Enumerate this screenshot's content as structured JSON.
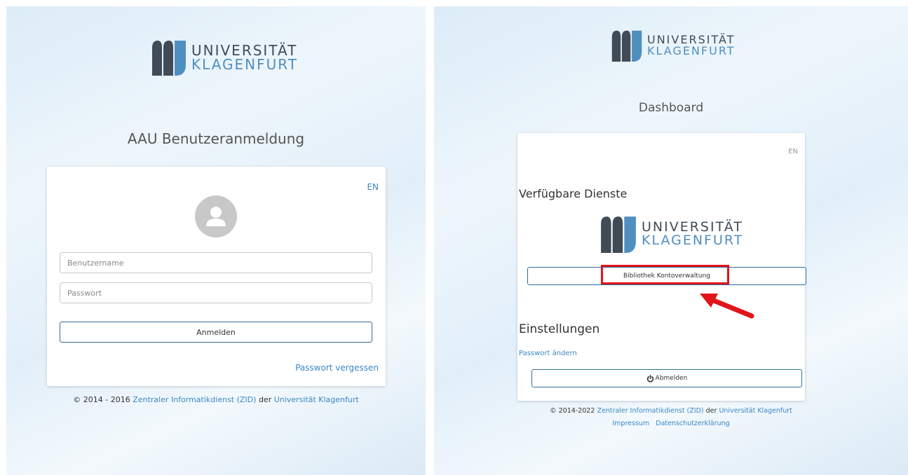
{
  "login": {
    "logo": {
      "line1": "UNIVERSITÄT",
      "line2": "KLAGENFURT"
    },
    "title": "AAU Benutzeranmeldung",
    "lang": "EN",
    "username_placeholder": "Benutzername",
    "password_placeholder": "Passwort",
    "submit_label": "Anmelden",
    "forgot_label": "Passwort vergessen",
    "footer": {
      "copyright": "© 2014 - 2016",
      "zid_link": "Zentraler Informatikdienst (ZID)",
      "der": "der",
      "uni_link": "Universität Klagenfurt"
    }
  },
  "dashboard": {
    "logo": {
      "line1": "UNIVERSITÄT",
      "line2": "KLAGENFURT"
    },
    "title": "Dashboard",
    "lang": "EN",
    "services_heading": "Verfügbare Dienste",
    "service_logo": {
      "line1": "UNIVERSITÄT",
      "line2": "KLAGENFURT"
    },
    "library_button": "Bibliothek Kontoverwaltung",
    "settings_heading": "Einstellungen",
    "change_password": "Passwort ändern",
    "logout_label": "Abmelden",
    "footer": {
      "copyright": "© 2014-2022",
      "zid_link": "Zentraler Informatikdienst (ZID)",
      "der": "der",
      "uni_link": "Universität Klagenfurt",
      "impressum": "Impressum",
      "privacy": "Datenschutzerklärung"
    }
  },
  "annotation": {
    "highlight_color": "#e0141a",
    "arrow_color": "#e0141a"
  },
  "colors": {
    "logo_dark": "#3f4c57",
    "logo_blue": "#4f8fc0",
    "link": "#3a87c4"
  }
}
